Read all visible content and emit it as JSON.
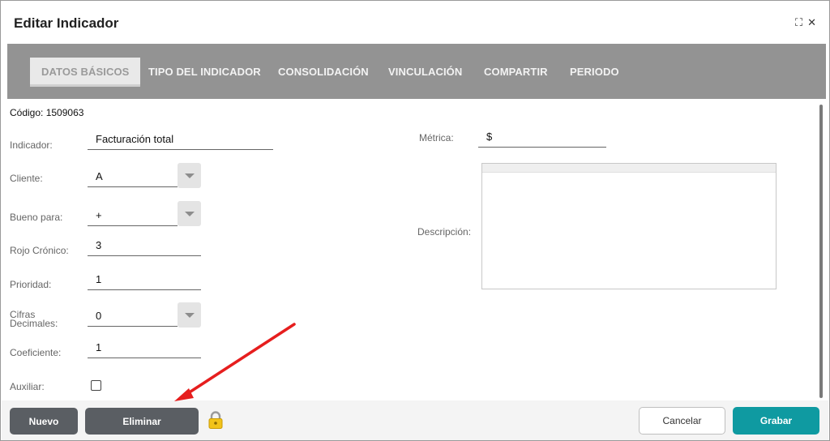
{
  "window": {
    "title": "Editar Indicador",
    "expand_icon": "expand-icon",
    "close_icon": "close-icon"
  },
  "tabs": [
    {
      "label": "DATOS BÁSICOS",
      "active": true
    },
    {
      "label": "TIPO DEL INDICADOR",
      "active": false
    },
    {
      "label": "CONSOLIDACIÓN",
      "active": false
    },
    {
      "label": "VINCULACIÓN",
      "active": false
    },
    {
      "label": "COMPARTIR",
      "active": false
    },
    {
      "label": "PERIODO",
      "active": false
    }
  ],
  "codigo": "Código: 1509063",
  "fields": {
    "indicador": {
      "label": "Indicador:",
      "value": "Facturación total"
    },
    "cliente": {
      "label": "Cliente:",
      "value": "A"
    },
    "bueno_para": {
      "label": "Bueno para:",
      "value": "+"
    },
    "rojo_cronico": {
      "label": "Rojo Crónico:",
      "value": "3"
    },
    "prioridad": {
      "label": "Prioridad:",
      "value": "1"
    },
    "cifras_decimales": {
      "label_line1": "Cifras",
      "label_line2": "Decimales:",
      "value": "0"
    },
    "coeficiente": {
      "label": "Coeficiente:",
      "value": "1"
    },
    "auxiliar": {
      "label": "Auxiliar:",
      "checked": false
    },
    "metrica": {
      "label": "Métrica:",
      "value": "$"
    },
    "descripcion": {
      "label": "Descripción:",
      "value": ""
    }
  },
  "footer": {
    "nuevo": "Nuevo",
    "eliminar": "Eliminar",
    "cancelar": "Cancelar",
    "grabar": "Grabar",
    "lock_icon": "lock-icon"
  },
  "colors": {
    "tabbar": "#939393",
    "primary_button": "#0f9aa1",
    "dark_button": "#5a5e63",
    "annotation_arrow": "#e61e1e"
  }
}
